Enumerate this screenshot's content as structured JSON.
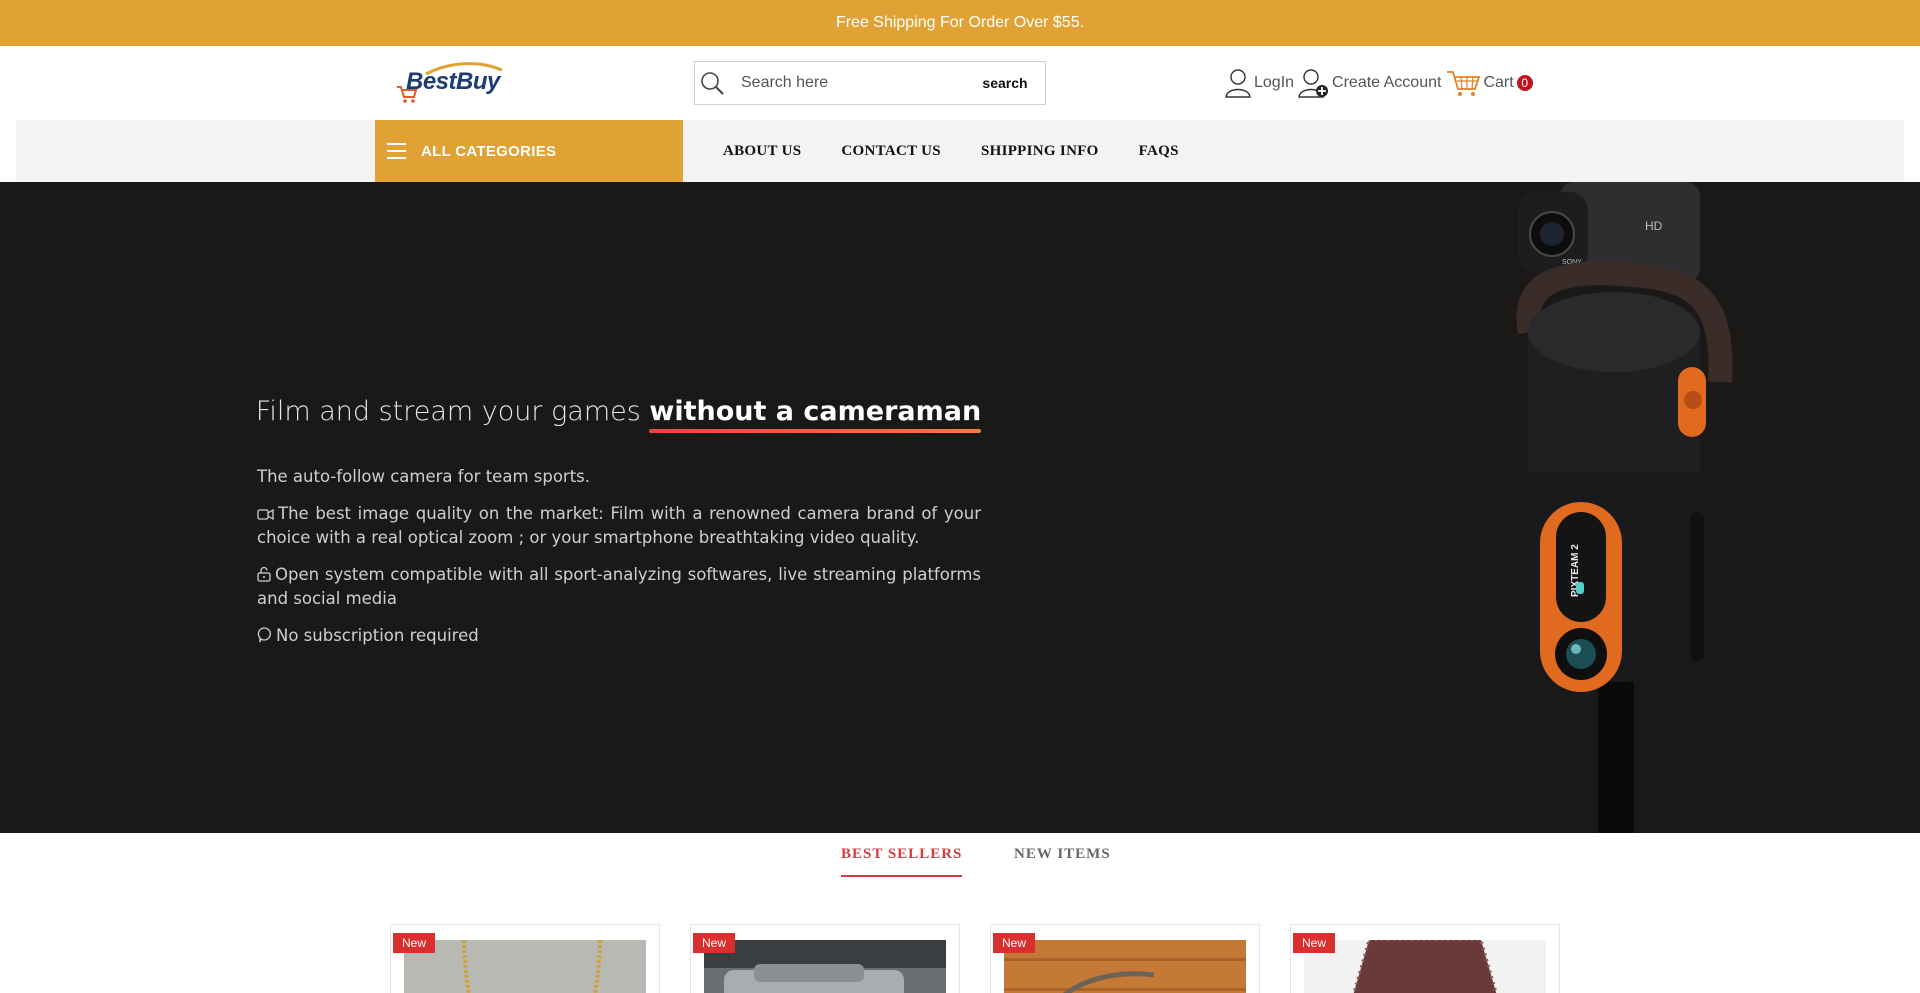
{
  "topbar": {
    "text": "Free Shipping For Order Over $55."
  },
  "header": {
    "logo_text": "BestBuy",
    "search": {
      "placeholder": "Search here",
      "button_label": "search"
    },
    "login_label": "LogIn",
    "create_account_label": "Create Account",
    "cart_label": "Cart",
    "cart_count": "0"
  },
  "nav": {
    "all_categories_label": "ALL CATEGORIES",
    "links": [
      "ABOUT US",
      "CONTACT US",
      "SHIPPING INFO",
      "FAQS"
    ]
  },
  "hero": {
    "title_prefix": "Film and stream your games ",
    "title_emphasis": "without a cameraman",
    "lines": [
      "The auto-follow camera for team sports.",
      "The best image quality on the market: Film with a renowned camera brand of your choice with a real optical zoom ; or your smartphone breathtaking video quality.",
      "Open system compatible with all sport-analyzing softwares, live streaming platforms and social media",
      "No subscription required"
    ],
    "product_label": "PIXTEAM 2",
    "camera_brand": "SONY",
    "camera_hd": "HD"
  },
  "tabs": {
    "best_sellers": "BEST SELLERS",
    "new_items": "NEW ITEMS"
  },
  "products": [
    {
      "badge": "New"
    },
    {
      "badge": "New"
    },
    {
      "badge": "New"
    },
    {
      "badge": "New"
    }
  ],
  "colors": {
    "accent": "#e0a234",
    "hero_bg": "#1b1918",
    "tab_active": "#d23c3c",
    "badge": "#d92f2f"
  }
}
